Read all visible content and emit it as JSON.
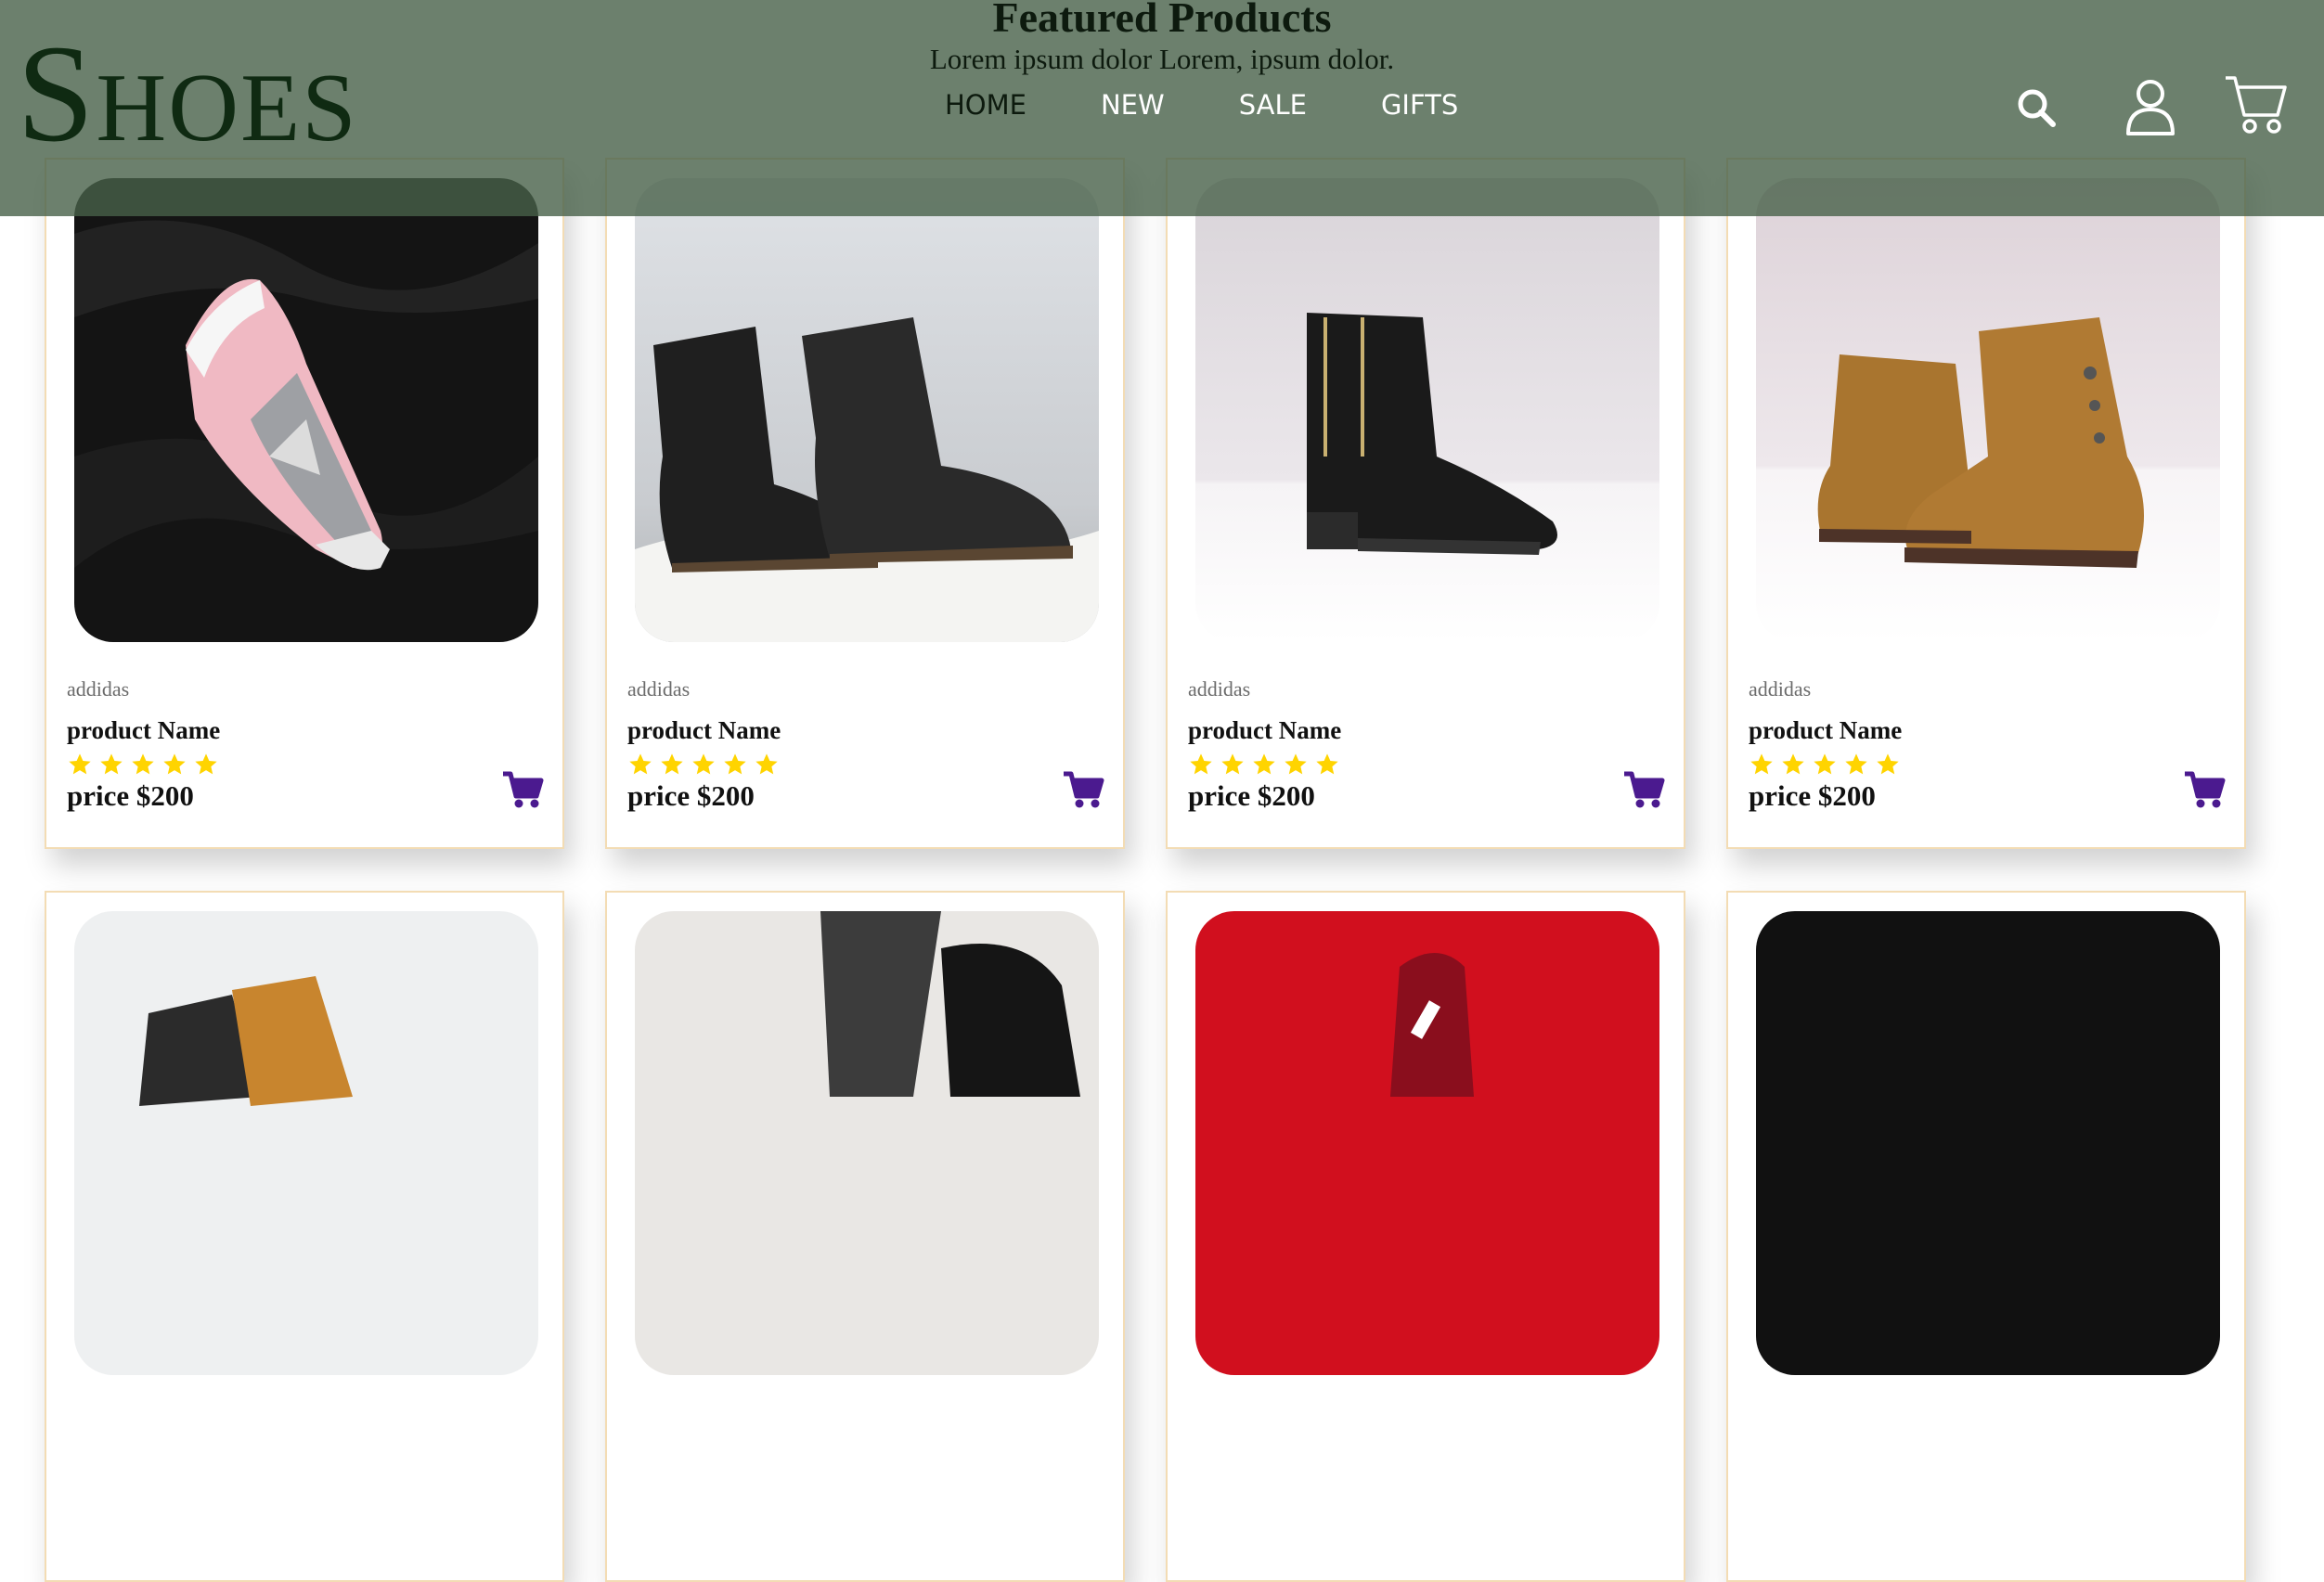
{
  "header": {
    "logo": "Shoes",
    "title": "Featured Products",
    "subtitle": "Lorem ipsum dolor Lorem, ipsum dolor.",
    "nav": [
      "HOME",
      "NEW",
      "SALE",
      "GIFTS"
    ],
    "active_nav": "HOME",
    "icons": [
      "search-icon",
      "user-icon",
      "cart-icon"
    ]
  },
  "products": [
    {
      "brand": "addidas",
      "name": "product Name",
      "price": "price $200",
      "rating": 5,
      "image": "pink-sneaker"
    },
    {
      "brand": "addidas",
      "name": "product Name",
      "price": "price $200",
      "rating": 5,
      "image": "black-lace-up-boots"
    },
    {
      "brand": "addidas",
      "name": "product Name",
      "price": "price $200",
      "rating": 5,
      "image": "black-zip-ankle-boot"
    },
    {
      "brand": "addidas",
      "name": "product Name",
      "price": "price $200",
      "rating": 5,
      "image": "tan-ankle-boots"
    }
  ],
  "products_row2_images": [
    "tan-leather-boots",
    "black-heels-on-fur",
    "red-nike-sneaker",
    "black-background-shoe"
  ],
  "colors": {
    "header_bg": "#476049",
    "star": "#ffd400",
    "cart_button": "#4b1a8f",
    "card_border": "#f3dcb4"
  }
}
